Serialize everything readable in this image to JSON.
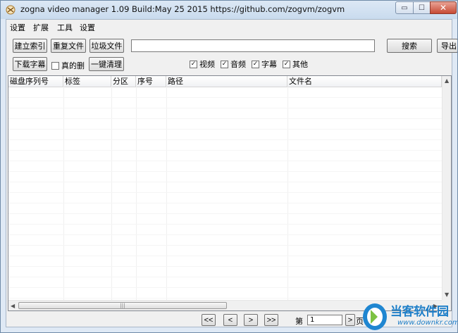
{
  "window": {
    "title": "zogna video manager 1.09 Build:May 25 2015  https://github.com/zogvm/zogvm",
    "controls": {
      "minimize": "▭",
      "maximize": "☐",
      "close": "✕"
    }
  },
  "menu": [
    "设置",
    "扩展",
    "工具",
    "设置"
  ],
  "toolbar": {
    "build_index": "建立索引",
    "duplicate_files": "重复文件",
    "junk_files": "垃圾文件",
    "search_value": "",
    "search_button": "搜索",
    "export_button": "导出",
    "download_subtitles": "下载字幕",
    "really_delete": "真的删",
    "one_click_clean": "一键清理"
  },
  "filters": [
    {
      "label": "视频",
      "checked": true
    },
    {
      "label": "音频",
      "checked": true
    },
    {
      "label": "字幕",
      "checked": true
    },
    {
      "label": "其他",
      "checked": true
    }
  ],
  "table": {
    "columns": [
      "磁盘序列号",
      "标签",
      "分区",
      "序号",
      "路径",
      "文件名"
    ],
    "rows": []
  },
  "scroll": {
    "up": "▲",
    "down": "▼",
    "left": "◀",
    "right": "▶",
    "grip": "|||"
  },
  "pagination": {
    "first": "<<",
    "prev": "<",
    "next": ">",
    "last": ">>",
    "page_prefix": "第",
    "page_value": "1",
    "page_suffix": "页"
  },
  "watermark": {
    "name": "当客软件园",
    "url": "www.downkr.com"
  },
  "colors": {
    "title_bg": "#dce8f5",
    "close_red": "#c74a34",
    "brand_blue": "#1f7fc8"
  }
}
